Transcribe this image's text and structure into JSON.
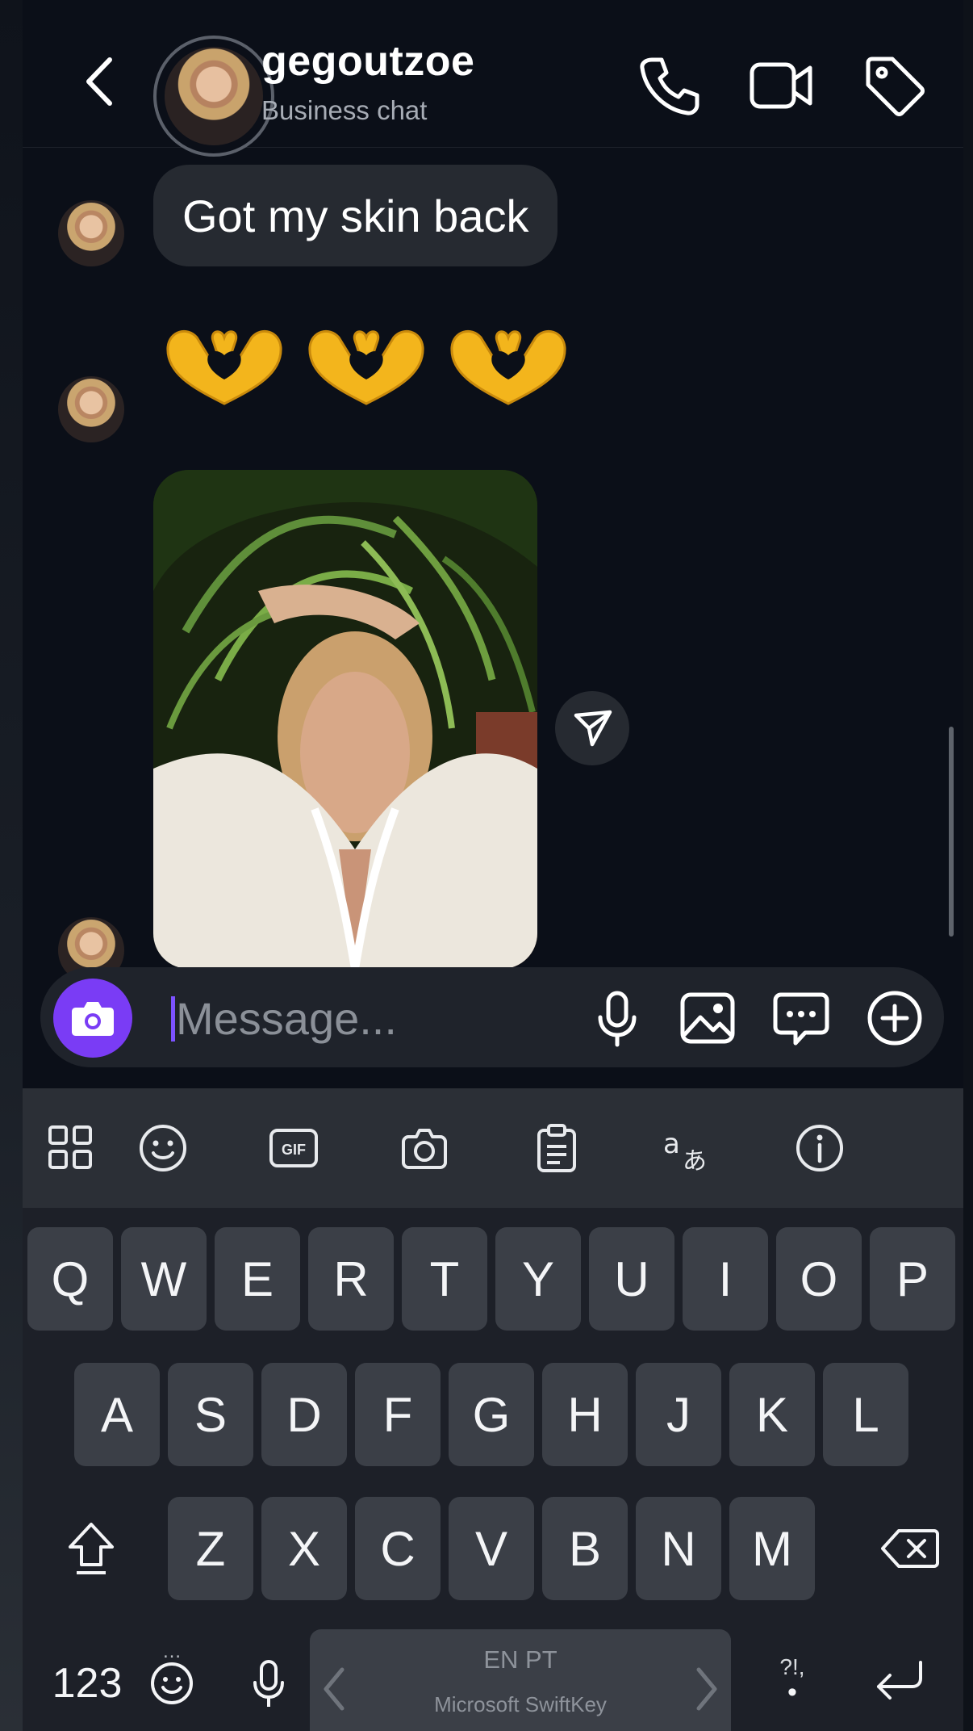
{
  "header": {
    "name": "gegoutzoe",
    "subtitle": "Business chat"
  },
  "messages": {
    "text_bubble": "Got my skin back",
    "emoji": [
      "🫶",
      "🫶",
      "🫶"
    ]
  },
  "composer": {
    "placeholder": "Message..."
  },
  "keyboard": {
    "rows": [
      [
        "Q",
        "W",
        "E",
        "R",
        "T",
        "Y",
        "U",
        "I",
        "O",
        "P"
      ],
      [
        "A",
        "S",
        "D",
        "F",
        "G",
        "H",
        "J",
        "K",
        "L"
      ],
      [
        "Z",
        "X",
        "C",
        "V",
        "B",
        "N",
        "M"
      ]
    ],
    "numbers_label": "123",
    "space_language": "EN PT",
    "space_brand": "Microsoft SwiftKey",
    "punct_label": "?!,",
    "toolbar_gif_label": "GIF"
  },
  "colors": {
    "accent": "#7a3cf5",
    "background": "#0b0f18",
    "bubble": "#262a31",
    "key": "#3b3f47"
  }
}
